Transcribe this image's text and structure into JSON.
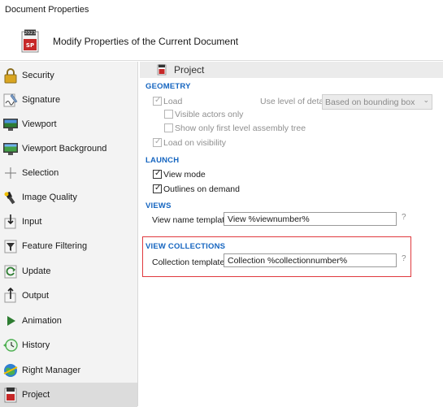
{
  "window": {
    "title": "Document Properties"
  },
  "header": {
    "title": "Modify Properties of the Current Document",
    "icon": "document-properties-icon"
  },
  "sidebar": {
    "items": [
      {
        "label": "Security",
        "icon": "padlock-icon"
      },
      {
        "label": "Signature",
        "icon": "signature-icon"
      },
      {
        "label": "Viewport",
        "icon": "monitor-icon"
      },
      {
        "label": "Viewport Background",
        "icon": "monitor-background-icon"
      },
      {
        "label": "Selection",
        "icon": "crosshair-icon"
      },
      {
        "label": "Image Quality",
        "icon": "flashlight-icon"
      },
      {
        "label": "Input",
        "icon": "input-arrow-icon"
      },
      {
        "label": "Feature Filtering",
        "icon": "filter-icon"
      },
      {
        "label": "Update",
        "icon": "update-icon"
      },
      {
        "label": "Output",
        "icon": "output-arrow-icon"
      },
      {
        "label": "Animation",
        "icon": "play-icon"
      },
      {
        "label": "History",
        "icon": "history-icon"
      },
      {
        "label": "Right Manager",
        "icon": "globe-icon"
      },
      {
        "label": "Project",
        "icon": "project-icon"
      }
    ],
    "selected": "Project"
  },
  "panel": {
    "title": "Project",
    "geometry": {
      "section": "GEOMETRY",
      "load": "Load",
      "level_label": "Use level of detail",
      "level_value": "Based on bounding box",
      "visible_actors": "Visible actors only",
      "first_level": "Show only first level assembly tree",
      "load_visibility": "Load on visibility"
    },
    "launch": {
      "section": "LAUNCH",
      "view_mode": "View mode",
      "outlines": "Outlines on demand"
    },
    "views": {
      "section": "VIEWS",
      "name_label": "View name template",
      "name_value": "View %viewnumber%",
      "help": "?"
    },
    "view_collections": {
      "section": "VIEW COLLECTIONS",
      "template_label": "Collection template",
      "template_value": "Collection %collectionnumber%",
      "help": "?"
    }
  },
  "colors": {
    "section_heading": "#1565c0",
    "highlight": "#e0393e",
    "selected_bg": "#dcdcdc"
  }
}
